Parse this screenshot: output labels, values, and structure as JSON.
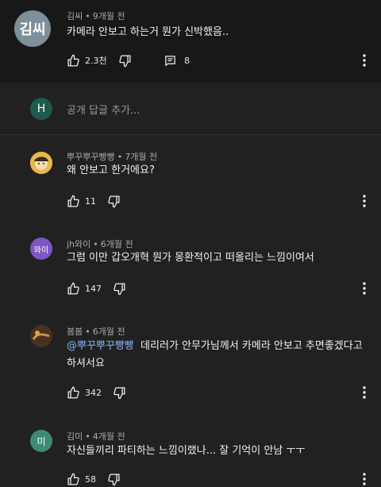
{
  "top_comment": {
    "avatar_text": "김씨",
    "author": "김씨",
    "time": "9개월 전",
    "text": "카메라 안보고 하는거 뭔가 신박했음..",
    "likes": "2.3천",
    "replies_count": "8"
  },
  "reply_input": {
    "avatar_letter": "H",
    "placeholder": "공개 답글 추가..."
  },
  "replies": [
    {
      "author": "뿌꾸뿌꾸빵빵",
      "time": "7개월 전",
      "text": "왜 안보고 한거에요?",
      "likes": "11"
    },
    {
      "author": "jh와이",
      "avatar_text": "와이",
      "time": "6개월 전",
      "text": "그럼 이만 갑오개혁 뭔가 몽환적이고 떠올리는 느낌이여서",
      "likes": "147"
    },
    {
      "author": "봄봄",
      "time": "6개월 전",
      "mention": "@뿌꾸뿌꾸빵빵",
      "text": "데리러가 안무가님께서 카메라 안보고 추면좋겠다고",
      "text_cont": "하셔서요",
      "likes": "342"
    },
    {
      "author": "김미",
      "avatar_text": "미",
      "time": "4개월 전",
      "text": "자신들끼리 파티하는 느낌이랬나... 잘 기억이 안남 ㅜㅜ",
      "likes": "58"
    }
  ],
  "colors": {
    "background": "#212121",
    "top_background": "#181818",
    "mention": "#8ab4f8",
    "meta_text": "#aaaaaa"
  }
}
